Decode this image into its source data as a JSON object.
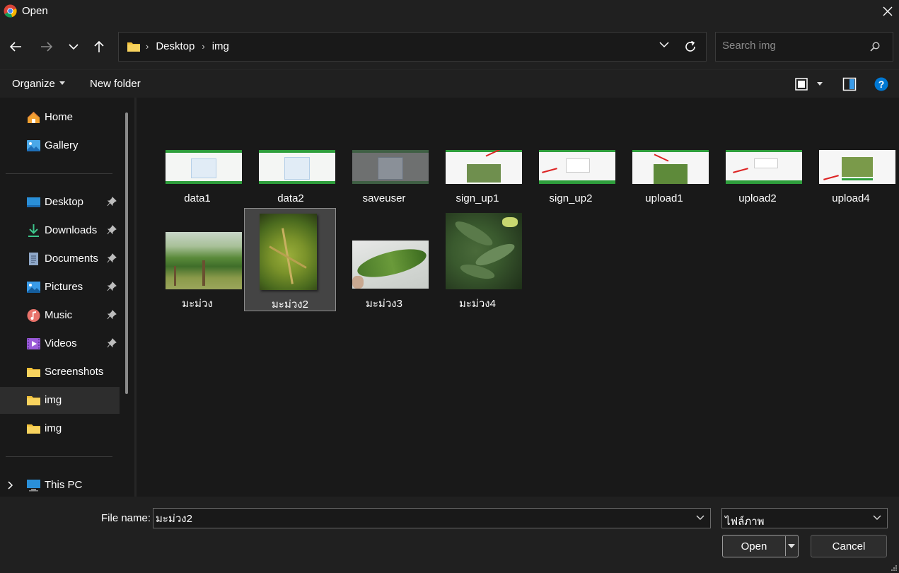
{
  "window": {
    "title": "Open"
  },
  "address": {
    "crumbs": [
      "Desktop",
      "img"
    ]
  },
  "search": {
    "placeholder": "Search img"
  },
  "toolbar": {
    "organize": "Organize",
    "new_folder": "New folder"
  },
  "sidebar": {
    "quick": [
      {
        "label": "Home",
        "icon": "home-icon"
      },
      {
        "label": "Gallery",
        "icon": "gallery-icon"
      }
    ],
    "pinned": [
      {
        "label": "Desktop",
        "icon": "desktop-icon",
        "pinned": true
      },
      {
        "label": "Downloads",
        "icon": "downloads-icon",
        "pinned": true
      },
      {
        "label": "Documents",
        "icon": "documents-icon",
        "pinned": true
      },
      {
        "label": "Pictures",
        "icon": "pictures-icon",
        "pinned": true
      },
      {
        "label": "Music",
        "icon": "music-icon",
        "pinned": true
      },
      {
        "label": "Videos",
        "icon": "videos-icon",
        "pinned": true
      },
      {
        "label": "Screenshots",
        "icon": "folder-icon",
        "pinned": false
      },
      {
        "label": "img",
        "icon": "folder-icon",
        "pinned": false,
        "selected": true
      },
      {
        "label": "img",
        "icon": "folder-icon",
        "pinned": false
      }
    ],
    "this_pc": {
      "label": "This PC",
      "icon": "computer-icon"
    }
  },
  "files": [
    {
      "name": "data1",
      "kind": "screenshot"
    },
    {
      "name": "data2",
      "kind": "screenshot"
    },
    {
      "name": "saveuser",
      "kind": "screenshot"
    },
    {
      "name": "sign_up1",
      "kind": "screenshot"
    },
    {
      "name": "sign_up2",
      "kind": "screenshot"
    },
    {
      "name": "upload1",
      "kind": "screenshot"
    },
    {
      "name": "upload2",
      "kind": "screenshot"
    },
    {
      "name": "upload4",
      "kind": "screenshot"
    },
    {
      "name": "มะม่วง",
      "kind": "photo"
    },
    {
      "name": "มะม่วง2",
      "kind": "photo",
      "selected": true
    },
    {
      "name": "มะม่วง3",
      "kind": "photo"
    },
    {
      "name": "มะม่วง4",
      "kind": "photo"
    }
  ],
  "footer": {
    "file_name_label": "File name:",
    "file_name_value": "มะม่วง2",
    "file_type": "ไฟล์ภาพ",
    "open_label": "Open",
    "cancel_label": "Cancel"
  },
  "colors": {
    "accent": "#0078d4",
    "help": "#0078d4",
    "folder": "#f3c13a",
    "leaf_green": "#4a8a2a"
  }
}
